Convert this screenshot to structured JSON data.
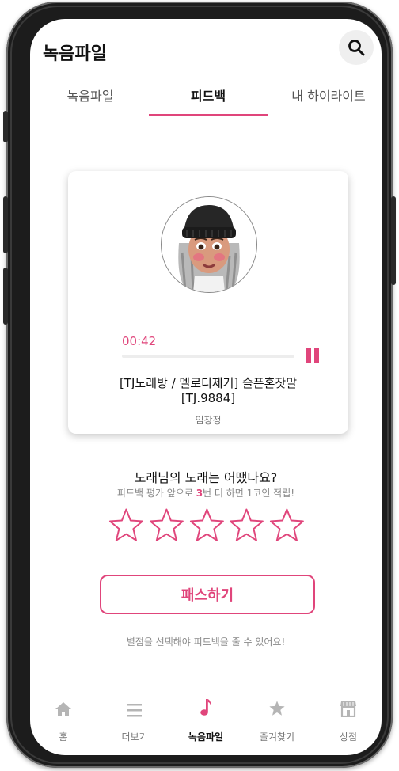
{
  "header": {
    "title": "녹음파일",
    "search_icon": "search-icon"
  },
  "tabs": [
    {
      "label": "녹음파일",
      "active": false
    },
    {
      "label": "피드백",
      "active": true
    },
    {
      "label": "내 하이라이트",
      "active": false
    }
  ],
  "player": {
    "time": "00:42",
    "progress": 0.0,
    "song_title": "[TJ노래방 / 멜로디제거] 슬픈혼잣말",
    "song_code": "[TJ.9884]",
    "singer": "임창정",
    "pause_icon": "pause-icon"
  },
  "rating": {
    "question": "노래님의 노래는 어땠나요?",
    "hint_before": "피드백 평가 앞으로 ",
    "hint_count": "3",
    "hint_after": "번 더 하면 1코인 적립!",
    "stars": 5,
    "selected": 0,
    "star_color": "#e0457b"
  },
  "pass_button": {
    "label": "패스하기"
  },
  "notice": "별점을 선택해야 피드백을 줄 수 있어요!",
  "bottom_nav": [
    {
      "label": "홈",
      "icon": "home-icon",
      "active": false
    },
    {
      "label": "더보기",
      "icon": "menu-icon",
      "active": false
    },
    {
      "label": "녹음파일",
      "icon": "music-note-icon",
      "active": true
    },
    {
      "label": "즐겨찾기",
      "icon": "star-icon",
      "active": false
    },
    {
      "label": "상점",
      "icon": "store-icon",
      "active": false
    }
  ],
  "colors": {
    "accent": "#e0457b",
    "frame": "#1c1c1c"
  }
}
